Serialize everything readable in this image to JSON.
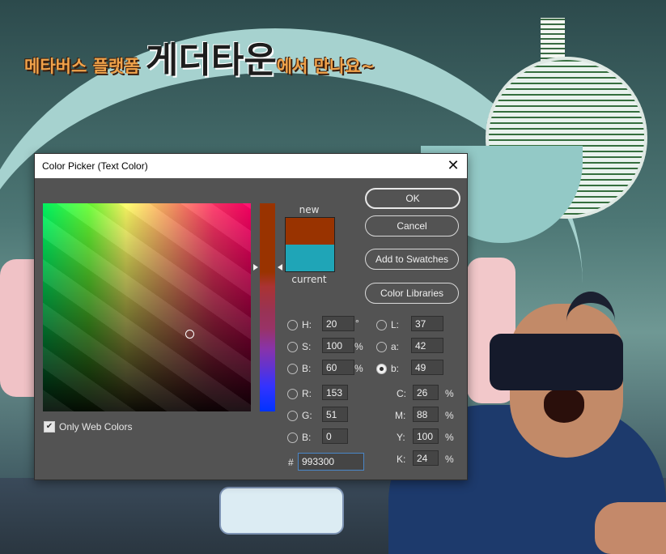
{
  "background": {
    "banner": {
      "part1": "메타버스 플랫폼 ",
      "part2": "게더타운",
      "part3": "에서 만나요~"
    },
    "globe_text": "",
    "colors": {
      "arch": "#a6d2cf",
      "globe_line": "#356e3e",
      "shirt": "#1d3a6c"
    }
  },
  "dialog": {
    "title": "Color Picker (Text Color)",
    "close_icon": "close-icon",
    "new_label": "new",
    "current_label": "current",
    "new_color": "#993300",
    "current_color": "#1fa5b7",
    "buttons": {
      "ok": "OK",
      "cancel": "Cancel",
      "add_to_swatches": "Add to Swatches",
      "color_libraries": "Color Libraries"
    },
    "hsb": {
      "h_label": "H:",
      "h_value": "20",
      "h_unit": "°",
      "s_label": "S:",
      "s_value": "100",
      "s_unit": "%",
      "b_label": "B:",
      "b_value": "60",
      "b_unit": "%"
    },
    "lab": {
      "l_label": "L:",
      "l_value": "37",
      "a_label": "a:",
      "a_value": "42",
      "b_label": "b:",
      "b_value": "49"
    },
    "rgb": {
      "r_label": "R:",
      "r_value": "153",
      "g_label": "G:",
      "g_value": "51",
      "b_label": "B:",
      "b_value": "0"
    },
    "cmyk": {
      "c_label": "C:",
      "c_value": "26",
      "m_label": "M:",
      "m_value": "88",
      "y_label": "Y:",
      "y_value": "100",
      "k_label": "K:",
      "k_value": "24",
      "unit": "%"
    },
    "hex_label": "#",
    "hex_value": "993300",
    "only_web_colors_label": "Only Web Colors",
    "only_web_colors_checked": true,
    "selected_channel": "lab-b"
  }
}
